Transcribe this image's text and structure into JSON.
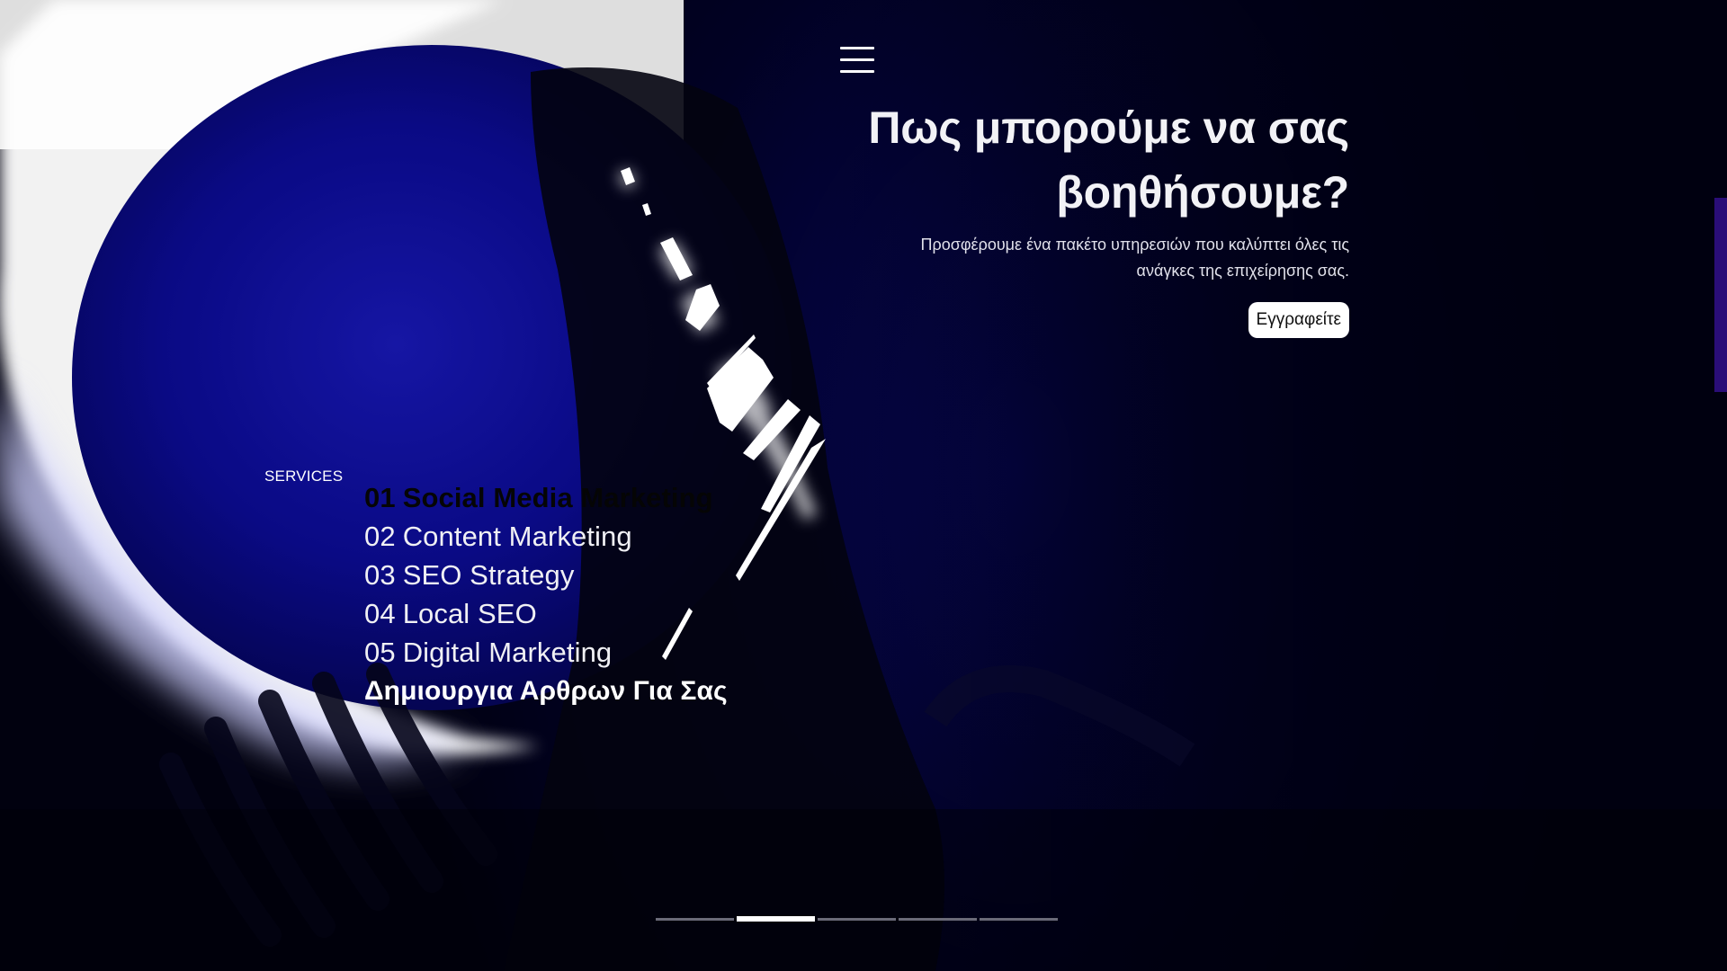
{
  "header": {
    "menu_icon": "hamburger-icon"
  },
  "hero": {
    "title_line1": "Πως μπορούμε να σας",
    "title_line2": "βοηθήσουμε?",
    "description_line1": "Προσφέρουμε ένα πακέτο υπηρεσιών που καλύπτει όλες τις",
    "description_line2": "ανάγκες της επιχείρησης σας.",
    "cta_label": "Εγγραφείτε"
  },
  "services": {
    "label": "SERVICES",
    "items": [
      {
        "num": "01",
        "label": "Social Media Marketing",
        "active": true
      },
      {
        "num": "02",
        "label": "Content Marketing",
        "active": false
      },
      {
        "num": "03",
        "label": "SEO Strategy",
        "active": false
      },
      {
        "num": "04",
        "label": "Local SEO",
        "active": false
      },
      {
        "num": "05",
        "label": "Digital Marketing",
        "active": false
      },
      {
        "num": "",
        "label": "Δημιουργια Αρθρων Για Σας",
        "active": false
      }
    ]
  },
  "pager": {
    "count": 5,
    "active_index": 1
  },
  "colors": {
    "background": "#02021a",
    "accent_blue": "#0a0a7a",
    "text": "#ffffff",
    "scroll_indicator": "#2a0d78"
  }
}
